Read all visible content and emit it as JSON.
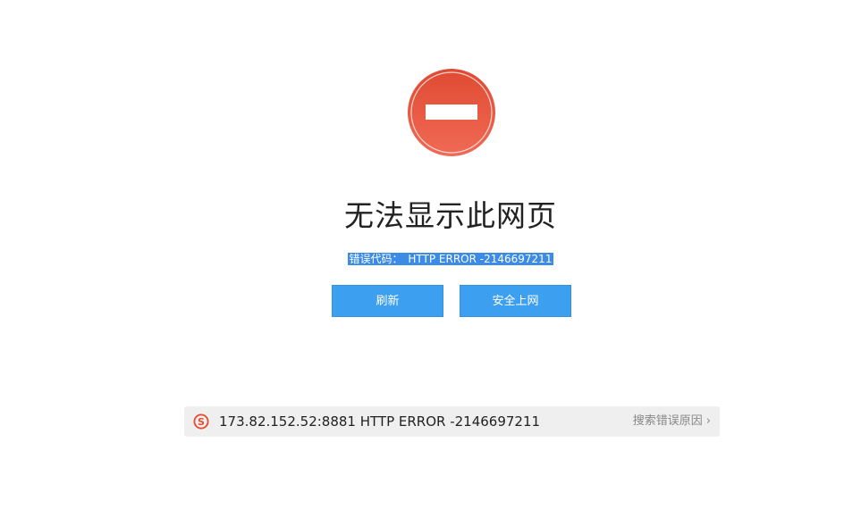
{
  "error": {
    "icon": "no-entry-icon",
    "title": "无法显示此网页",
    "code_label": "错误代码：",
    "code_value": "HTTP ERROR -2146697211"
  },
  "buttons": {
    "refresh": "刷新",
    "safe_browse": "安全上网"
  },
  "search": {
    "icon": "sogou-logo-icon",
    "query": "173.82.152.52:8881 HTTP ERROR -2146697211",
    "link": "搜索错误原因",
    "chevron": "›"
  },
  "colors": {
    "icon_red": "#e8533b",
    "button_blue": "#3d9ff0",
    "selection_blue": "#3c8ce6",
    "search_bg": "#efefef"
  }
}
